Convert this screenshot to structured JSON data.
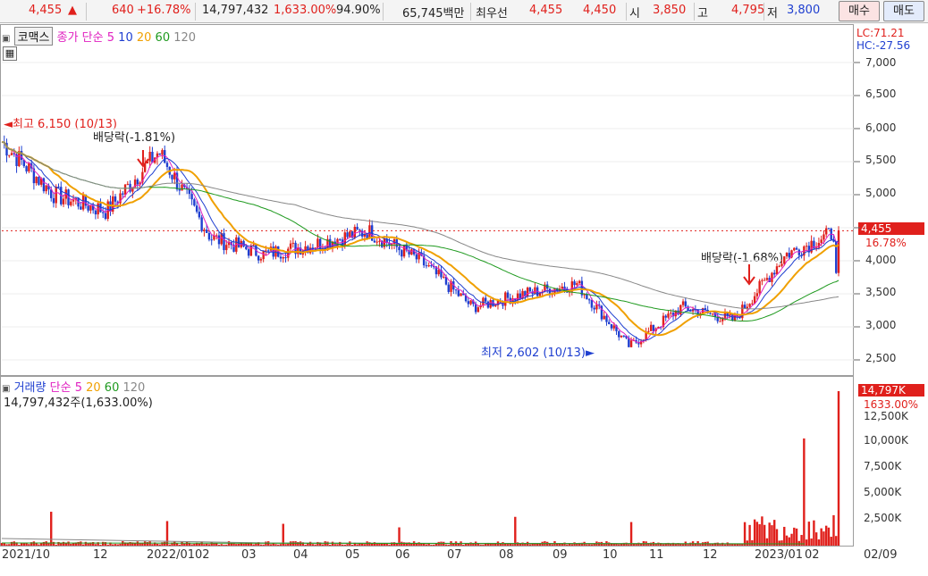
{
  "topbar": {
    "price": "4,455",
    "up_arrow": "▲",
    "change": "640",
    "change_pct": "+16.78%",
    "volume": "14,797,432",
    "volume_pct": "1,633.00%",
    "ratio": "94.90%",
    "amount": "65,745백만",
    "best_label": "최우선",
    "best_ask": "4,455",
    "best_bid": "4,450",
    "open_label": "시",
    "open": "3,850",
    "high_label": "고",
    "high": "4,795",
    "low_label": "저",
    "low": "3,800",
    "buy_label": "매수",
    "sell_label": "매도"
  },
  "price_pane": {
    "stock_name": "코맥스",
    "ma_label": "종가 단순",
    "ma_periods": [
      "5",
      "10",
      "20",
      "60",
      "120"
    ],
    "lc": "LC:71.21",
    "hc": "HC:-27.56",
    "last_price_tag": "4,455",
    "last_pct_tag": "16.78%",
    "high_note": "최고 6,150 (10/13)",
    "low_note": "최저 2,602 (10/13)",
    "div_note_1": "배당락(-1.81%)",
    "div_note_2": "배당락(-1.68%)",
    "y_labels": [
      "7,000",
      "6,500",
      "6,000",
      "5,500",
      "5,000",
      "4,500",
      "4,000",
      "3,500",
      "3,000",
      "2,500"
    ]
  },
  "volume_pane": {
    "title": "거래량",
    "ma_label": "단순",
    "ma_periods": [
      "5",
      "20",
      "60",
      "120"
    ],
    "volume_text": "14,797,432주(1,633.00%)",
    "last_volume_tag": "14,797K",
    "last_pct_tag": "1633.00%",
    "y_labels": [
      "12,500K",
      "10,000K",
      "7,500K",
      "5,000K",
      "2,500K"
    ]
  },
  "x_axis": [
    "2021/10",
    "12",
    "2022/01",
    "02",
    "03",
    "04",
    "05",
    "06",
    "07",
    "08",
    "09",
    "10",
    "11",
    "12",
    "2023/01",
    "02",
    "02/09"
  ],
  "colors": {
    "up": "#e0201c",
    "down": "#1f3fd0",
    "ma5": "#e020c0",
    "ma10": "#1f3fd0",
    "ma20": "#f0a000",
    "ma60": "#1f9a1f",
    "ma120": "#888888"
  },
  "chart_data": {
    "type": "candlestick",
    "price_axis": {
      "ylim": [
        2500,
        7000
      ]
    },
    "month_series": [
      {
        "x": "2021/10",
        "close": 5800
      },
      {
        "x": "11",
        "close": 5000
      },
      {
        "x": "12",
        "close": 4750
      },
      {
        "x": "2022/01",
        "close": 5650
      },
      {
        "x": "02",
        "close": 4350
      },
      {
        "x": "03",
        "close": 4100
      },
      {
        "x": "04",
        "close": 4250
      },
      {
        "x": "05",
        "close": 4450
      },
      {
        "x": "06",
        "close": 4000
      },
      {
        "x": "07",
        "close": 3300
      },
      {
        "x": "08",
        "close": 3500
      },
      {
        "x": "09",
        "close": 3650
      },
      {
        "x": "10",
        "close": 2700
      },
      {
        "x": "11",
        "close": 3300
      },
      {
        "x": "12",
        "close": 3100
      },
      {
        "x": "2023/01",
        "close": 4100
      },
      {
        "x": "02",
        "close": 4455
      }
    ]
  }
}
